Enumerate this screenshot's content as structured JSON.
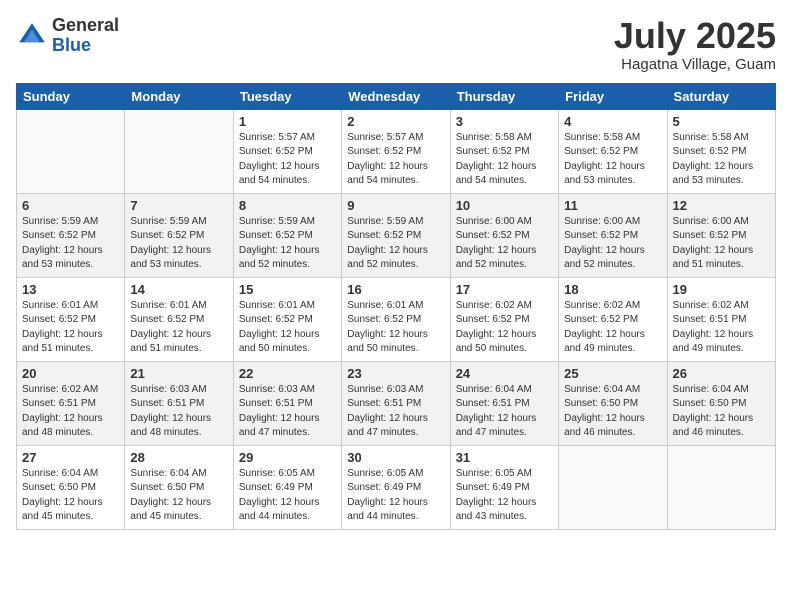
{
  "logo": {
    "general": "General",
    "blue": "Blue"
  },
  "title": {
    "month_year": "July 2025",
    "location": "Hagatna Village, Guam"
  },
  "weekdays": [
    "Sunday",
    "Monday",
    "Tuesday",
    "Wednesday",
    "Thursday",
    "Friday",
    "Saturday"
  ],
  "weeks": [
    [
      {
        "day": "",
        "info": ""
      },
      {
        "day": "",
        "info": ""
      },
      {
        "day": "1",
        "info": "Sunrise: 5:57 AM\nSunset: 6:52 PM\nDaylight: 12 hours\nand 54 minutes."
      },
      {
        "day": "2",
        "info": "Sunrise: 5:57 AM\nSunset: 6:52 PM\nDaylight: 12 hours\nand 54 minutes."
      },
      {
        "day": "3",
        "info": "Sunrise: 5:58 AM\nSunset: 6:52 PM\nDaylight: 12 hours\nand 54 minutes."
      },
      {
        "day": "4",
        "info": "Sunrise: 5:58 AM\nSunset: 6:52 PM\nDaylight: 12 hours\nand 53 minutes."
      },
      {
        "day": "5",
        "info": "Sunrise: 5:58 AM\nSunset: 6:52 PM\nDaylight: 12 hours\nand 53 minutes."
      }
    ],
    [
      {
        "day": "6",
        "info": "Sunrise: 5:59 AM\nSunset: 6:52 PM\nDaylight: 12 hours\nand 53 minutes."
      },
      {
        "day": "7",
        "info": "Sunrise: 5:59 AM\nSunset: 6:52 PM\nDaylight: 12 hours\nand 53 minutes."
      },
      {
        "day": "8",
        "info": "Sunrise: 5:59 AM\nSunset: 6:52 PM\nDaylight: 12 hours\nand 52 minutes."
      },
      {
        "day": "9",
        "info": "Sunrise: 5:59 AM\nSunset: 6:52 PM\nDaylight: 12 hours\nand 52 minutes."
      },
      {
        "day": "10",
        "info": "Sunrise: 6:00 AM\nSunset: 6:52 PM\nDaylight: 12 hours\nand 52 minutes."
      },
      {
        "day": "11",
        "info": "Sunrise: 6:00 AM\nSunset: 6:52 PM\nDaylight: 12 hours\nand 52 minutes."
      },
      {
        "day": "12",
        "info": "Sunrise: 6:00 AM\nSunset: 6:52 PM\nDaylight: 12 hours\nand 51 minutes."
      }
    ],
    [
      {
        "day": "13",
        "info": "Sunrise: 6:01 AM\nSunset: 6:52 PM\nDaylight: 12 hours\nand 51 minutes."
      },
      {
        "day": "14",
        "info": "Sunrise: 6:01 AM\nSunset: 6:52 PM\nDaylight: 12 hours\nand 51 minutes."
      },
      {
        "day": "15",
        "info": "Sunrise: 6:01 AM\nSunset: 6:52 PM\nDaylight: 12 hours\nand 50 minutes."
      },
      {
        "day": "16",
        "info": "Sunrise: 6:01 AM\nSunset: 6:52 PM\nDaylight: 12 hours\nand 50 minutes."
      },
      {
        "day": "17",
        "info": "Sunrise: 6:02 AM\nSunset: 6:52 PM\nDaylight: 12 hours\nand 50 minutes."
      },
      {
        "day": "18",
        "info": "Sunrise: 6:02 AM\nSunset: 6:52 PM\nDaylight: 12 hours\nand 49 minutes."
      },
      {
        "day": "19",
        "info": "Sunrise: 6:02 AM\nSunset: 6:51 PM\nDaylight: 12 hours\nand 49 minutes."
      }
    ],
    [
      {
        "day": "20",
        "info": "Sunrise: 6:02 AM\nSunset: 6:51 PM\nDaylight: 12 hours\nand 48 minutes."
      },
      {
        "day": "21",
        "info": "Sunrise: 6:03 AM\nSunset: 6:51 PM\nDaylight: 12 hours\nand 48 minutes."
      },
      {
        "day": "22",
        "info": "Sunrise: 6:03 AM\nSunset: 6:51 PM\nDaylight: 12 hours\nand 47 minutes."
      },
      {
        "day": "23",
        "info": "Sunrise: 6:03 AM\nSunset: 6:51 PM\nDaylight: 12 hours\nand 47 minutes."
      },
      {
        "day": "24",
        "info": "Sunrise: 6:04 AM\nSunset: 6:51 PM\nDaylight: 12 hours\nand 47 minutes."
      },
      {
        "day": "25",
        "info": "Sunrise: 6:04 AM\nSunset: 6:50 PM\nDaylight: 12 hours\nand 46 minutes."
      },
      {
        "day": "26",
        "info": "Sunrise: 6:04 AM\nSunset: 6:50 PM\nDaylight: 12 hours\nand 46 minutes."
      }
    ],
    [
      {
        "day": "27",
        "info": "Sunrise: 6:04 AM\nSunset: 6:50 PM\nDaylight: 12 hours\nand 45 minutes."
      },
      {
        "day": "28",
        "info": "Sunrise: 6:04 AM\nSunset: 6:50 PM\nDaylight: 12 hours\nand 45 minutes."
      },
      {
        "day": "29",
        "info": "Sunrise: 6:05 AM\nSunset: 6:49 PM\nDaylight: 12 hours\nand 44 minutes."
      },
      {
        "day": "30",
        "info": "Sunrise: 6:05 AM\nSunset: 6:49 PM\nDaylight: 12 hours\nand 44 minutes."
      },
      {
        "day": "31",
        "info": "Sunrise: 6:05 AM\nSunset: 6:49 PM\nDaylight: 12 hours\nand 43 minutes."
      },
      {
        "day": "",
        "info": ""
      },
      {
        "day": "",
        "info": ""
      }
    ]
  ]
}
